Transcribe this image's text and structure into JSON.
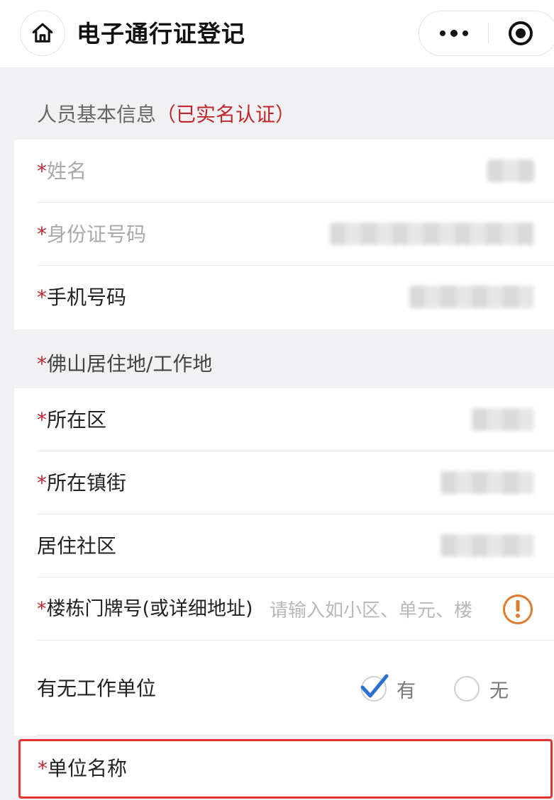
{
  "nav": {
    "title": "电子通行证登记",
    "home_icon": "home-icon",
    "more_icon": "more-dots-icon",
    "close_icon": "target-icon"
  },
  "basic": {
    "title": "人员基本信息",
    "tag": "（已实名认证）",
    "rows": [
      {
        "star": "*",
        "label": "姓名"
      },
      {
        "star": "*",
        "label": "身份证号码"
      },
      {
        "star": "*",
        "label": "手机号码"
      }
    ]
  },
  "residence": {
    "title_star": "*",
    "title": "佛山居住地/工作地",
    "district": {
      "star": "*",
      "label": "所在区"
    },
    "town": {
      "star": "*",
      "label": "所在镇街"
    },
    "community": {
      "label": "居住社区"
    },
    "address": {
      "star": "*",
      "label": "楼栋门牌号(或详细地址)",
      "placeholder": "请输入如小区、单元、楼",
      "warn_icon": "exclamation-circle-icon"
    }
  },
  "employer": {
    "label": "有无工作单位",
    "options": [
      "有",
      "无"
    ],
    "selected": "有"
  },
  "unit": {
    "star": "*",
    "label": "单位名称"
  },
  "colors": {
    "accent_red": "#c0282d",
    "highlight_border": "#e3342f",
    "warn": "#e07b2e",
    "check": "#2b6fd0"
  }
}
